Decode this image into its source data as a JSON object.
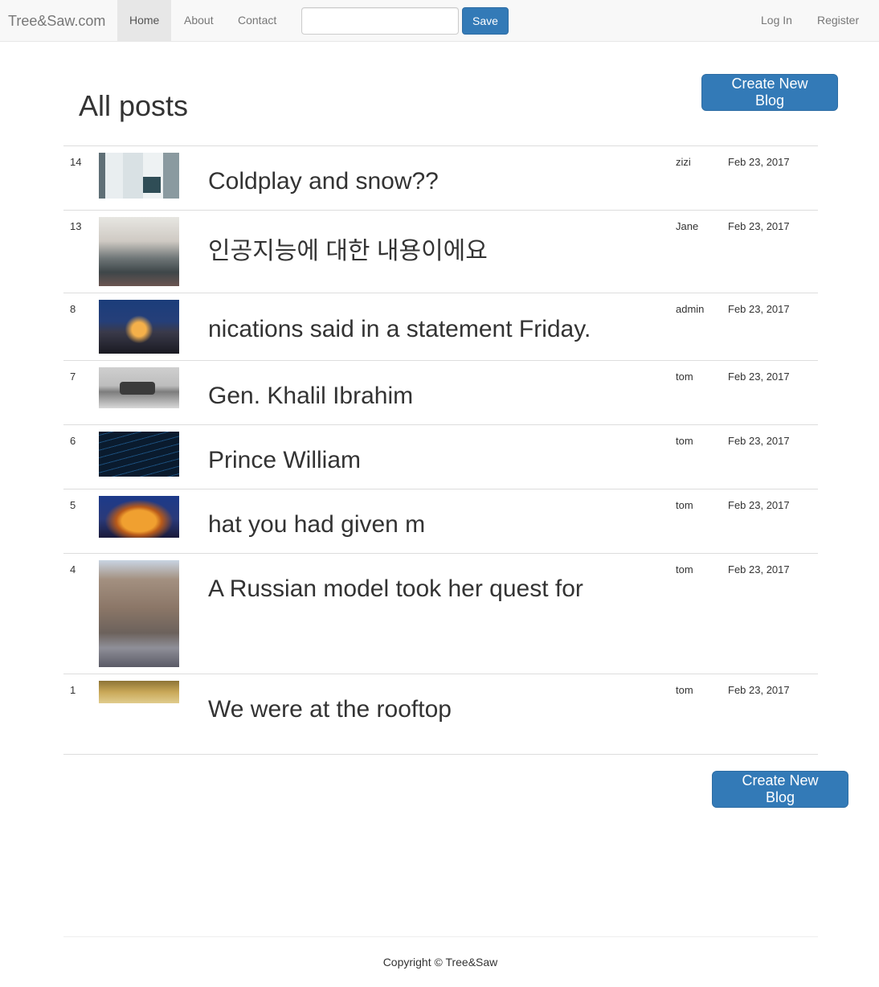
{
  "nav": {
    "brand": "Tree&Saw.com",
    "links": [
      "Home",
      "About",
      "Contact"
    ],
    "search_value": "",
    "save_label": "Save",
    "login": "Log In",
    "register": "Register"
  },
  "page": {
    "title": "All posts",
    "create_label": "Create New Blog"
  },
  "posts": [
    {
      "id": "14",
      "title": "Coldplay and snow??",
      "author": "zizi",
      "date": "Feb 23, 2017"
    },
    {
      "id": "13",
      "title": "인공지능에 대한 내용이에요",
      "author": "Jane",
      "date": "Feb 23, 2017"
    },
    {
      "id": "8",
      "title": "nications said in a statement Friday.",
      "author": "admin",
      "date": "Feb 23, 2017"
    },
    {
      "id": "7",
      "title": "Gen. Khalil Ibrahim",
      "author": "tom",
      "date": "Feb 23, 2017"
    },
    {
      "id": "6",
      "title": "Prince William",
      "author": "tom",
      "date": "Feb 23, 2017"
    },
    {
      "id": "5",
      "title": "hat you had given m",
      "author": "tom",
      "date": "Feb 23, 2017"
    },
    {
      "id": "4",
      "title": "A Russian model took her quest for",
      "author": "tom",
      "date": "Feb 23, 2017"
    },
    {
      "id": "1",
      "title": "We were at the rooftop",
      "author": "tom",
      "date": "Feb 23, 2017"
    }
  ],
  "footer": {
    "copyright": "Copyright © Tree&Saw"
  },
  "colors": {
    "primary": "#337ab7",
    "navbar_bg": "#f8f8f8",
    "border": "#dddddd"
  }
}
